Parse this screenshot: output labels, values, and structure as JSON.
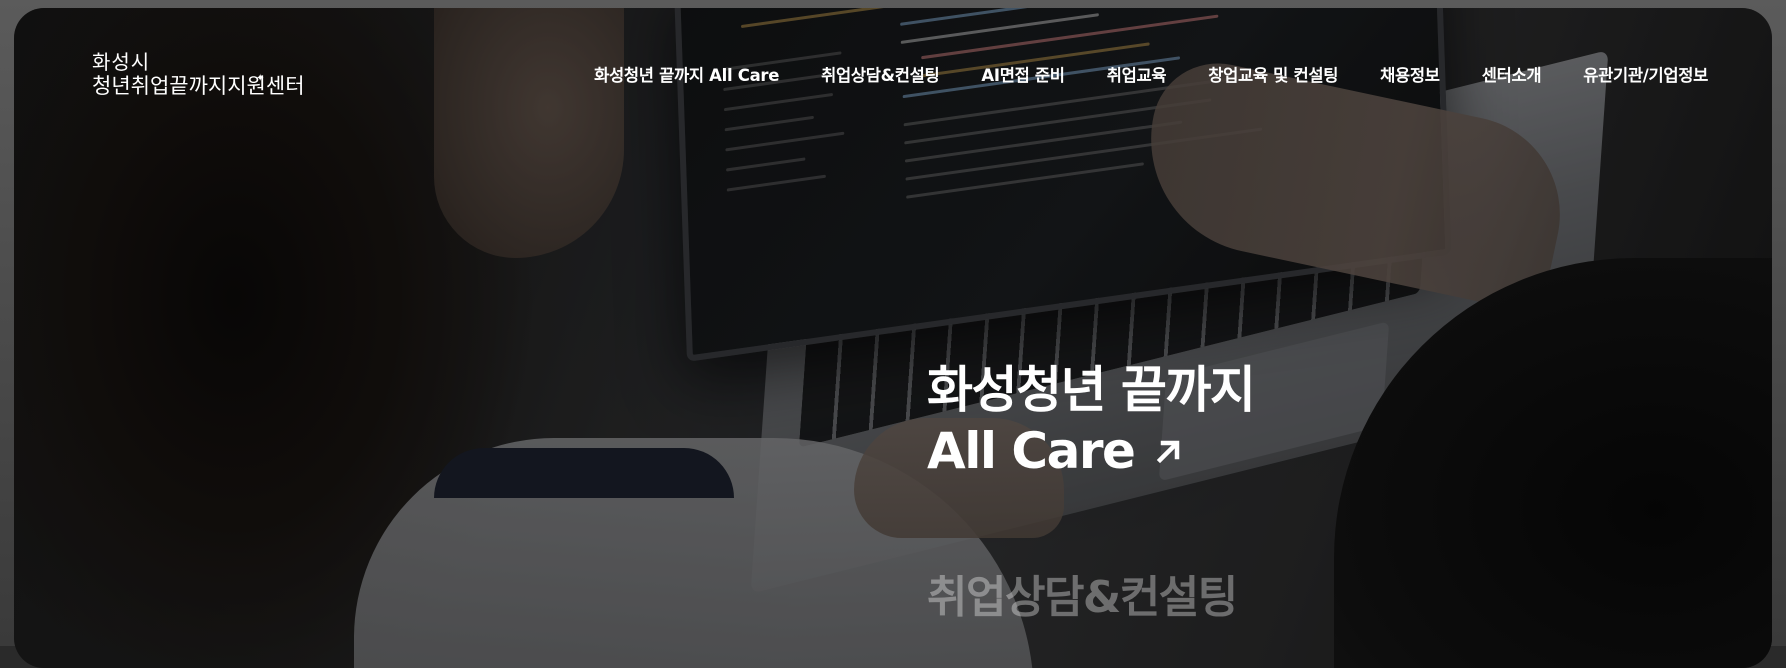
{
  "logo": {
    "line1": "화성시",
    "line2": "청년취업끝까지지원센터",
    "sparkle": "✦"
  },
  "nav": {
    "items": [
      "화성청년 끝까지 All Care",
      "취업상담&컨설팅",
      "AI면접 준비",
      "취업교육",
      "창업교육 및 컨설팅",
      "채용정보",
      "센터소개",
      "유관기관/기업정보"
    ]
  },
  "hero": {
    "title_line1": "화성청년 끝까지",
    "title_line2": "All Care",
    "arrow_icon": "arrow-up-right-icon",
    "next_slide_label": "취업상담&컨설팅"
  },
  "colors": {
    "text": "#ffffff",
    "overlay": "rgba(0,0,0,0.35)",
    "frame": "#1a1a1a"
  }
}
